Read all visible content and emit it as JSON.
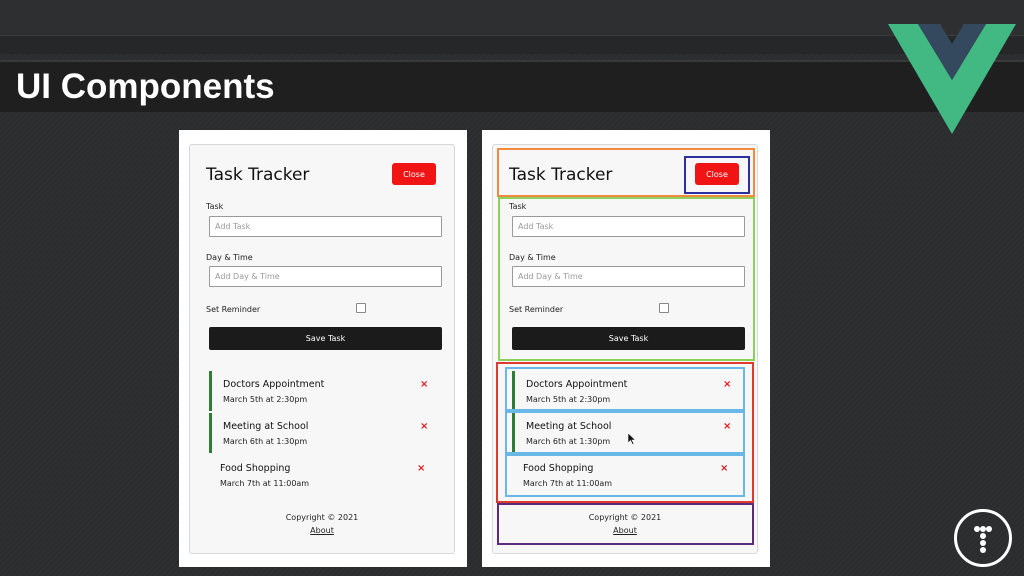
{
  "slide": {
    "title": "UI Components"
  },
  "app": {
    "title": "Task Tracker",
    "close_label": "Close",
    "form": {
      "task_label": "Task",
      "task_placeholder": "Add Task",
      "day_label": "Day & Time",
      "day_placeholder": "Add Day & Time",
      "reminder_label": "Set Reminder",
      "reminder_checked": false,
      "save_label": "Save Task"
    },
    "tasks": [
      {
        "text": "Doctors Appointment",
        "day": "March 5th at 2:30pm",
        "reminder": true,
        "delete_glyph": "×"
      },
      {
        "text": "Meeting at School",
        "day": "March 6th at 1:30pm",
        "reminder": true,
        "delete_glyph": "×"
      },
      {
        "text": "Food Shopping",
        "day": "March 7th at 11:00am",
        "reminder": false,
        "delete_glyph": "×"
      }
    ],
    "footer": {
      "copyright": "Copyright © 2021",
      "about": "About"
    }
  },
  "colors": {
    "close_button": "#f01414",
    "save_button": "#1b1b1b",
    "reminder_border": "#2f7d32",
    "delete_icon": "#e0161a",
    "highlight_header": "#f08a3c",
    "highlight_button": "#2b2fa0",
    "highlight_form": "#8ed05c",
    "highlight_tasks": "#e03a2f",
    "highlight_task_item": "#6ab8e8",
    "highlight_footer": "#5b2a7a",
    "vue_green": "#42b883",
    "vue_navy": "#35495e"
  },
  "icons": {
    "brand_logo": "vue-logo",
    "channel_logo": "t-logo",
    "delete": "close-x-icon",
    "pointer": "mouse-cursor"
  }
}
